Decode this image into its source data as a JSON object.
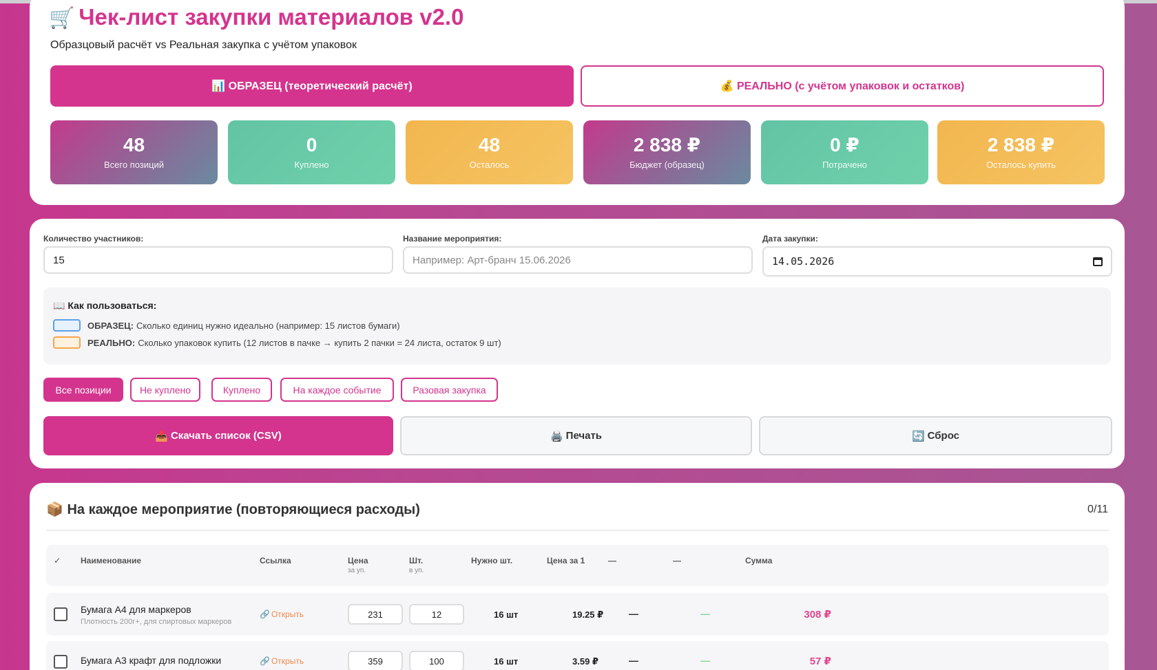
{
  "header": {
    "icon": "shopping-cart-icon",
    "title": "Чек-лист закупки материалов v2.0",
    "subtitle": "Образцовый расчёт vs Реальная закупка с учётом упаковок",
    "modes": {
      "sample": "📊 ОБРАЗЕЦ (теоретический расчёт)",
      "real": "💰 РЕАЛЬНО (с учётом упаковок и остатков)"
    },
    "stats": [
      {
        "value": "48",
        "label": "Всего позиций"
      },
      {
        "value": "0",
        "label": "Куплено"
      },
      {
        "value": "48",
        "label": "Осталось"
      },
      {
        "value": "2 838 ₽",
        "label": "Бюджет (образец)"
      },
      {
        "value": "0 ₽",
        "label": "Потрачено"
      },
      {
        "value": "2 838 ₽",
        "label": "Осталось купить"
      }
    ]
  },
  "controls": {
    "participants_label": "Количество участников:",
    "participants_value": "15",
    "event_label": "Название мероприятия:",
    "event_placeholder": "Например: Арт-бранч 15.06.2026",
    "date_label": "Дата закупки:",
    "date_value": "14.05.2026",
    "howto": {
      "title": "📖 Как пользоваться:",
      "sample_key": "ОБРАЗЕЦ:",
      "sample_text": "Сколько единиц нужно идеально (например: 15 листов бумаги)",
      "real_key": "РЕАЛЬНО:",
      "real_text": "Сколько упаковок купить (12 листов в пачке → купить 2 пачки = 24 листа, остаток 9 шт)"
    },
    "filters": [
      "Все позиции",
      "Не куплено",
      "Куплено",
      "На каждое событие",
      "Разовая закупка"
    ],
    "actions": {
      "download": "Скачать список (CSV)",
      "print": "Печать",
      "reset": "Сброс"
    }
  },
  "section": {
    "title": "📦 На каждое мероприятие (повторяющиеся расходы)",
    "count": "0/11",
    "columns": {
      "check": "✓",
      "name": "Наименование",
      "link": "Ссылка",
      "price": "Цена",
      "price_sub": "за уп.",
      "qty": "Шт.",
      "qty_sub": "в уп.",
      "need": "Нужно шт.",
      "unit_price": "Цена за 1",
      "dash1": "—",
      "dash2": "—",
      "sum": "Сумма"
    },
    "rows": [
      {
        "name": "Бумага А4 для маркеров",
        "desc": "Плотность 200г+, для спиртовых маркеров",
        "link": "Открыть",
        "price": "231",
        "qty": "12",
        "need": "16 шт",
        "unit": "19.25 ₽",
        "d1": "—",
        "d2": "—",
        "sum": "308 ₽"
      },
      {
        "name": "Бумага А3 крафт для подложки",
        "desc": "",
        "link": "Открыть",
        "price": "359",
        "qty": "100",
        "need": "16 шт",
        "unit": "3.59 ₽",
        "d1": "—",
        "d2": "—",
        "sum": "57 ₽"
      }
    ]
  }
}
